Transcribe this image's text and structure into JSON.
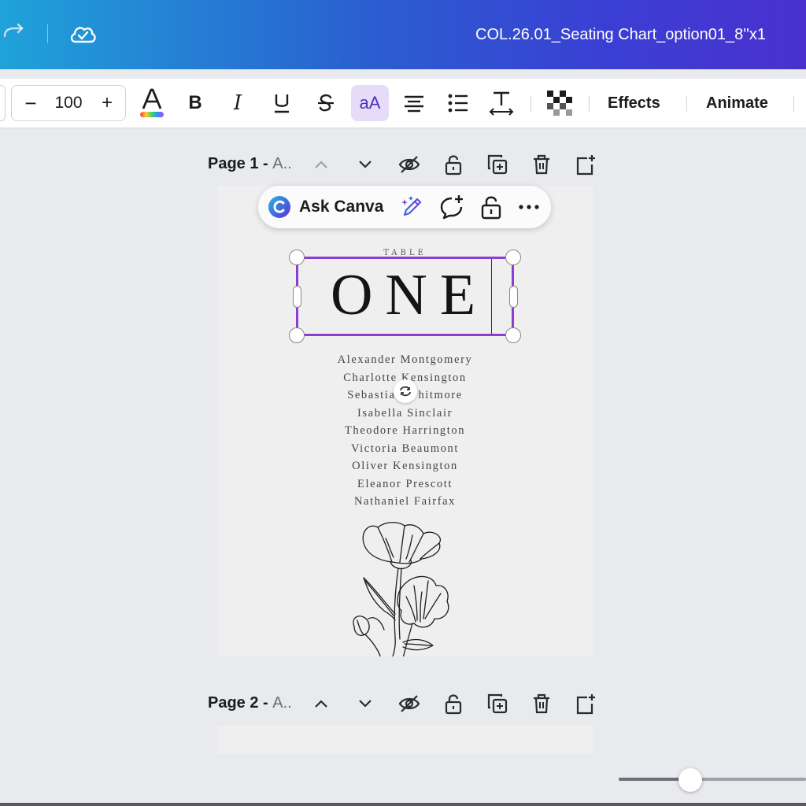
{
  "header": {
    "doc_title": "COL.26.01_Seating Chart_option01_8''x1",
    "icons": [
      "redo-icon",
      "cloud-saved-icon"
    ]
  },
  "toolbar": {
    "font_size": "100",
    "minus_label": "−",
    "plus_label": "+",
    "text_color_label": "A",
    "bold_label": "B",
    "italic_label": "I",
    "case_label": "aA",
    "effects_label": "Effects",
    "animate_label": "Animate",
    "accent_color": "#e6dcf7"
  },
  "pages": [
    {
      "label": "Page 1 - ",
      "title": "A.."
    },
    {
      "label": "Page 2 - ",
      "title": "A.."
    }
  ],
  "context_bar": {
    "ask_label": "Ask Canva",
    "more_label": "•••"
  },
  "design": {
    "table_label": "TABLE",
    "table_number": "ONE",
    "guests": [
      "Alexander Montgomery",
      "Charlotte Kensington",
      "Sebastian Whitmore",
      "Isabella Sinclair",
      "Theodore Harrington",
      "Victoria Beaumont",
      "Oliver Kensington",
      "Eleanor Prescott",
      "Nathaniel Fairfax"
    ],
    "selection_color": "#8b3dd6"
  }
}
